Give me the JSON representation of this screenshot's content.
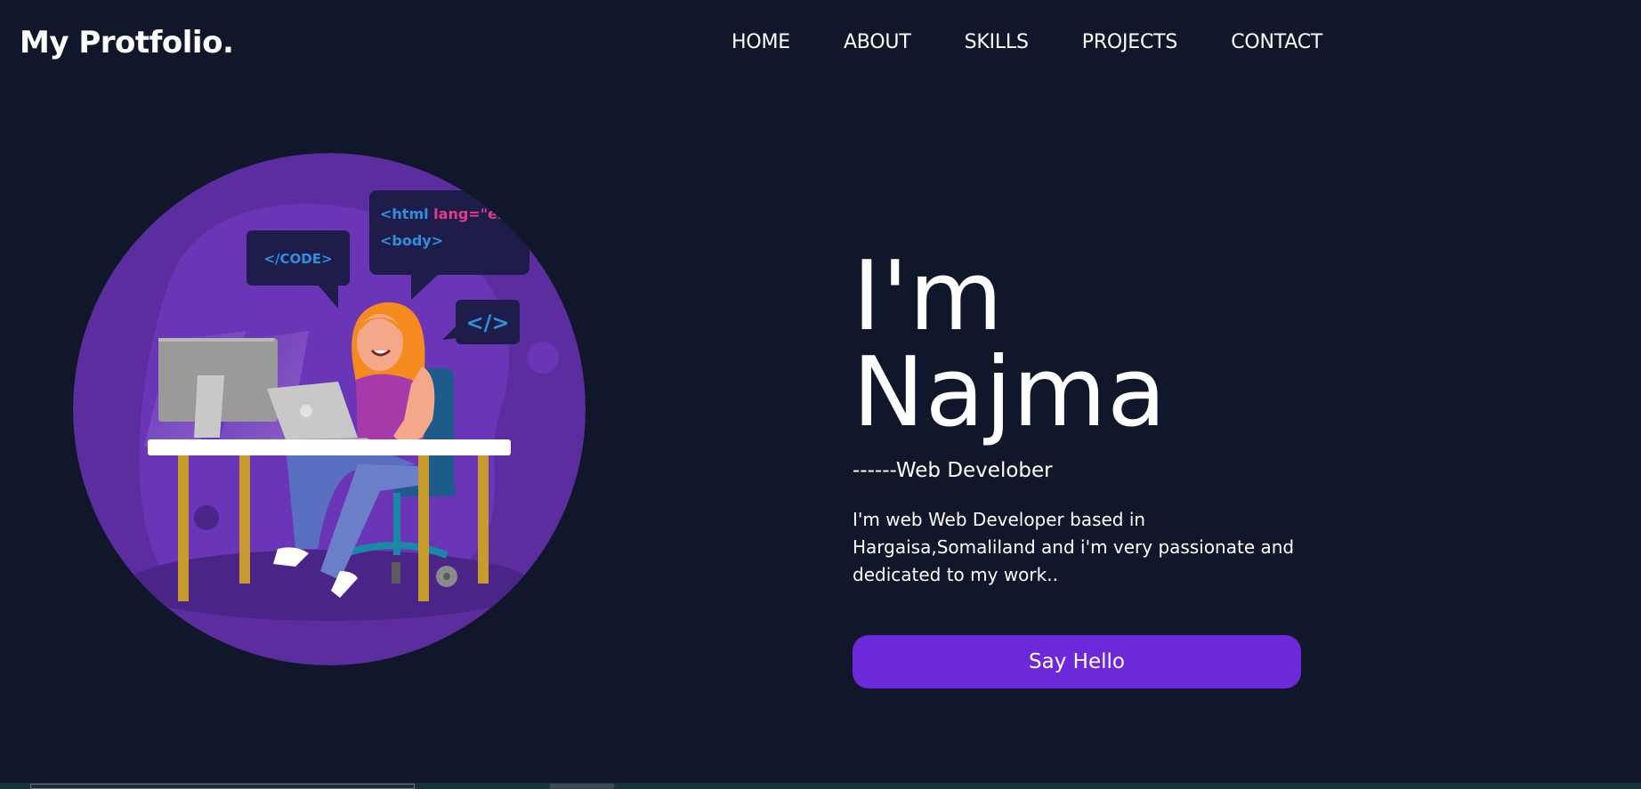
{
  "navbar": {
    "logo": "My Protfolio.",
    "links": [
      {
        "label": "HOME"
      },
      {
        "label": "ABOUT"
      },
      {
        "label": "SKILLS"
      },
      {
        "label": "PROJECTS"
      },
      {
        "label": "CONTACT"
      }
    ]
  },
  "illustration": {
    "code_bubble_1": "</CODE>",
    "code_bubble_2_line1_tag": "<html ",
    "code_bubble_2_line1_attr": "lang",
    "code_bubble_2_line1_val": "=\"en",
    "code_bubble_2_line2": "<body>",
    "code_bubble_3": "</>"
  },
  "hero": {
    "title": "I'm Najma",
    "subtitle": "------Web Develober",
    "description": "I'm web Web Developer based in Hargaisa,Somaliland and i'm very passionate and dedicated to my work..",
    "cta_label": "Say Hello"
  },
  "colors": {
    "background": "#10172a",
    "accent": "#6d28d9",
    "circle": "#5b2d9e"
  }
}
